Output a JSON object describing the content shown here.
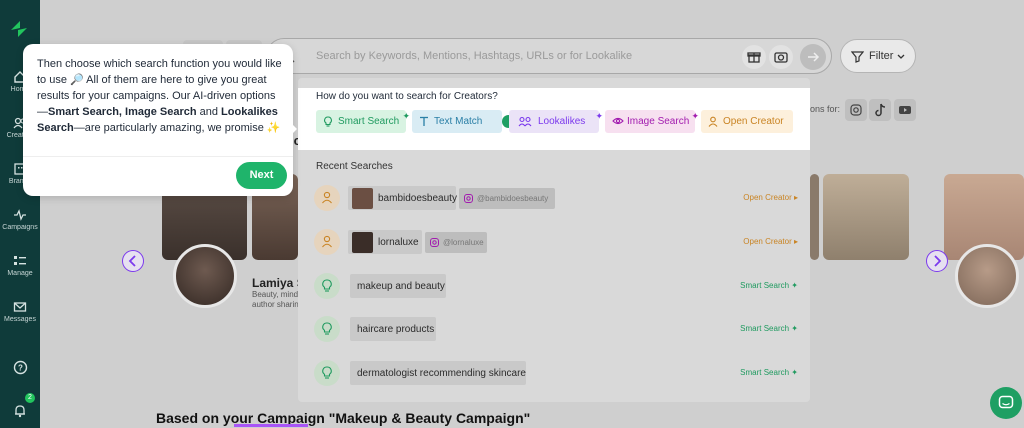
{
  "sidebar": {
    "items": [
      {
        "label": "Home"
      },
      {
        "label": "Creators"
      },
      {
        "label": "Brands"
      },
      {
        "label": "Campaigns"
      },
      {
        "label": "Manage"
      },
      {
        "label": "Messages"
      }
    ],
    "notification_count": "2"
  },
  "search": {
    "placeholder": "Search by Keywords, Mentions, Hashtags, URLs or for Lookalike",
    "filter_label": "Filter"
  },
  "background": {
    "social_label": "ons for:",
    "creator_name": "Lamiya Sl",
    "creator_desc_1": "Beauty, minds",
    "creator_desc_2": "author sharin",
    "heading_prefix": "Based on your ",
    "heading_link": "Campaign",
    "heading_suffix": " \"Makeup & Beauty Campaign\"",
    "partial_letters": "ic"
  },
  "dropdown": {
    "question": "How do you want to search for Creators?",
    "options": [
      {
        "label": "Smart Search"
      },
      {
        "label": "Text Match"
      },
      {
        "label": "Lookalikes"
      },
      {
        "label": "Image Search"
      },
      {
        "label": "Open Creator"
      }
    ],
    "recent_title": "Recent Searches",
    "recent": [
      {
        "text": "bambidoesbeauty",
        "handle": "@bambidoesbeauty",
        "action": "Open Creator"
      },
      {
        "text": "lornaluxe",
        "handle": "@lornaluxe",
        "action": "Open Creator"
      },
      {
        "text": "makeup and beauty",
        "action": "Smart Search"
      },
      {
        "text": "haircare products",
        "action": "Smart Search"
      },
      {
        "text": "dermatologist recommending skincare",
        "action": "Smart Search"
      }
    ]
  },
  "tooltip": {
    "line_a": "Then choose which search function you would like to use ",
    "line_b": " All of them are here to give you great results for your campaigns. Our AI-driven options —",
    "bold_a": "Smart Search, Image Search",
    "and": " and ",
    "bold_b": "Lookalikes Search",
    "line_c": "—are particularly amazing, we promise ",
    "next_label": "Next"
  },
  "colors": {
    "accent_green": "#1fb46b",
    "sidebar_bg": "#0f3b3a",
    "smart_chip": "#d8f3e2",
    "text_chip": "#d9ecf4",
    "lookalike_chip": "#ebe3f7",
    "image_chip": "#f7e0f0",
    "open_chip": "#fdf0dc"
  }
}
